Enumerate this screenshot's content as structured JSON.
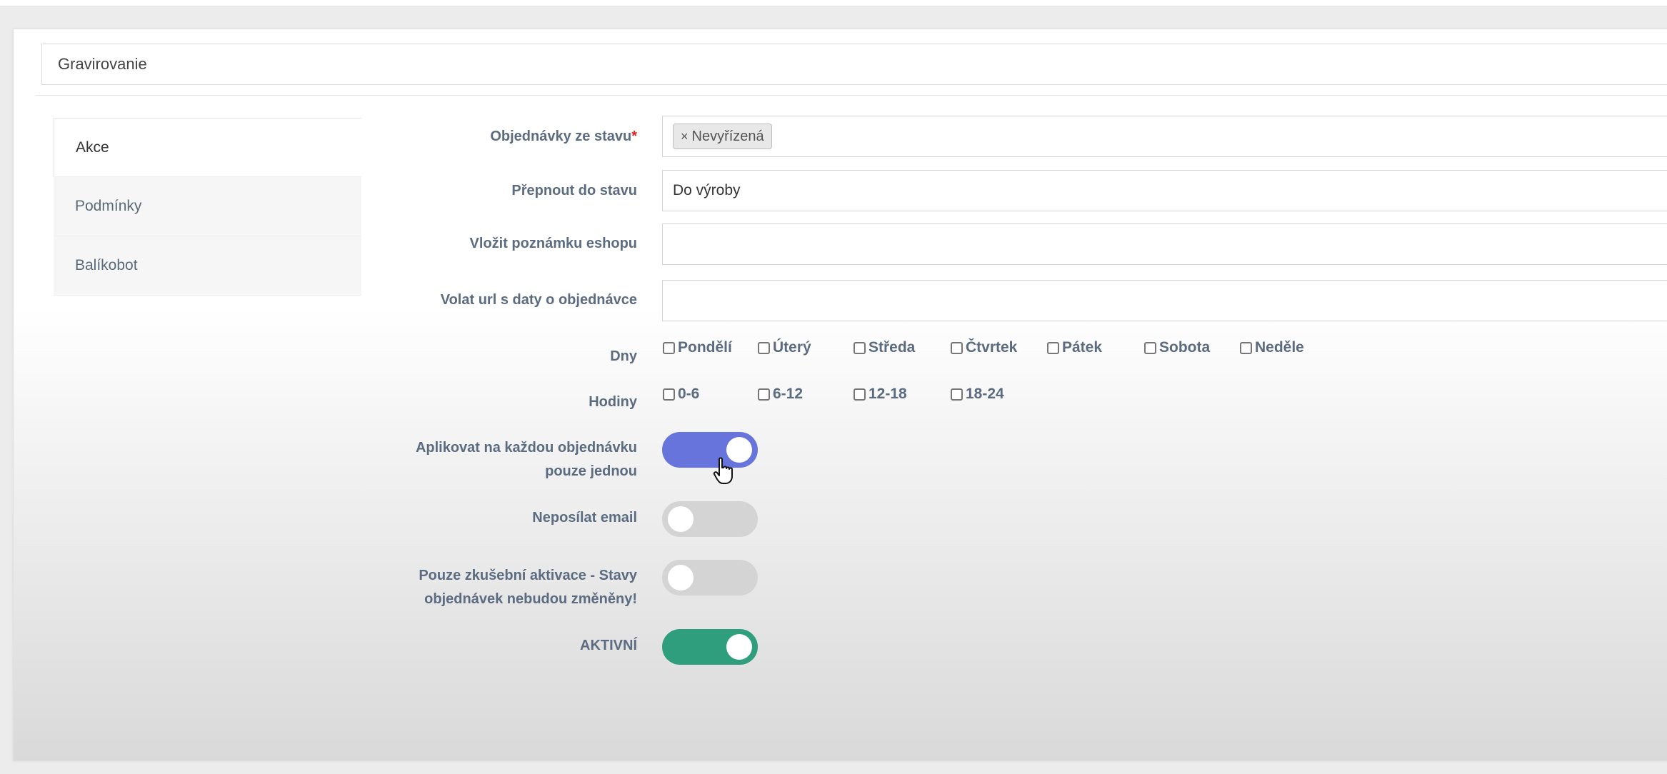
{
  "header": {
    "rule_name": "Gravirovanie"
  },
  "tabs": [
    {
      "label": "Akce"
    },
    {
      "label": "Podmínky"
    },
    {
      "label": "Balíkobot"
    }
  ],
  "fields": {
    "orders_from_state": {
      "label": "Objednávky ze stavu",
      "required_mark": "*",
      "tags": [
        "Nevyřízená"
      ],
      "tag_remove_symbol": "×"
    },
    "switch_to_state": {
      "label": "Přepnout do stavu",
      "value": "Do výroby"
    },
    "insert_note": {
      "label": "Vložit poznámku eshopu",
      "value": ""
    },
    "call_url": {
      "label": "Volat url s daty o objednávce",
      "value": ""
    }
  },
  "days": {
    "label": "Dny",
    "options": [
      "Pondělí",
      "Úterý",
      "Středa",
      "Čtvrtek",
      "Pátek",
      "Sobota",
      "Neděle"
    ]
  },
  "hours": {
    "label": "Hodiny",
    "options": [
      "0-6",
      "6-12",
      "12-18",
      "18-24"
    ]
  },
  "toggles": {
    "apply_once": {
      "label_line1": "Aplikovat na každou objednávku",
      "label_line2": "pouze jednou",
      "on": true,
      "color": "#6674dc"
    },
    "no_email": {
      "label": "Neposílat email",
      "on": false,
      "color": "#d4d4d4"
    },
    "test_only": {
      "label_line1": "Pouze zkušební aktivace - Stavy",
      "label_line2": "objednávek nebudou změněny!",
      "on": false,
      "color": "#d4d4d4"
    },
    "active": {
      "label": "AKTIVNÍ",
      "on": true,
      "color": "#2e9e7c"
    }
  }
}
